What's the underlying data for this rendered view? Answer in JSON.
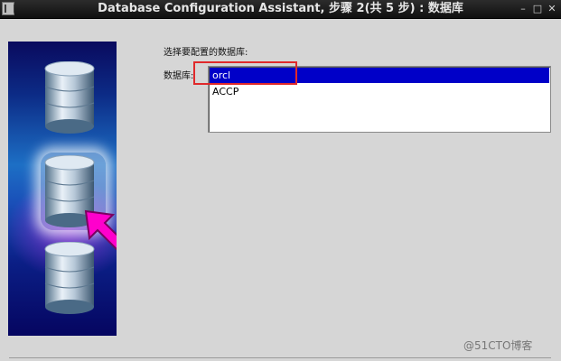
{
  "window": {
    "title": "Database Configuration Assistant, 步骤 2(共 5 步) : 数据库",
    "minimize_label": "–",
    "maximize_label": "□",
    "close_label": "✕"
  },
  "content": {
    "prompt": "选择要配置的数据库:",
    "database_label": "数据库:",
    "databases": [
      "orcl",
      "ACCP"
    ],
    "selected_database": "orcl"
  },
  "colors": {
    "selection": "#0000c8",
    "highlight_box": "#e0292b",
    "arrow": "#ff00cc"
  },
  "icons": [
    "app-icon",
    "database-cylinder-icon",
    "selection-arrow-icon"
  ],
  "watermark": "@51CTO博客"
}
